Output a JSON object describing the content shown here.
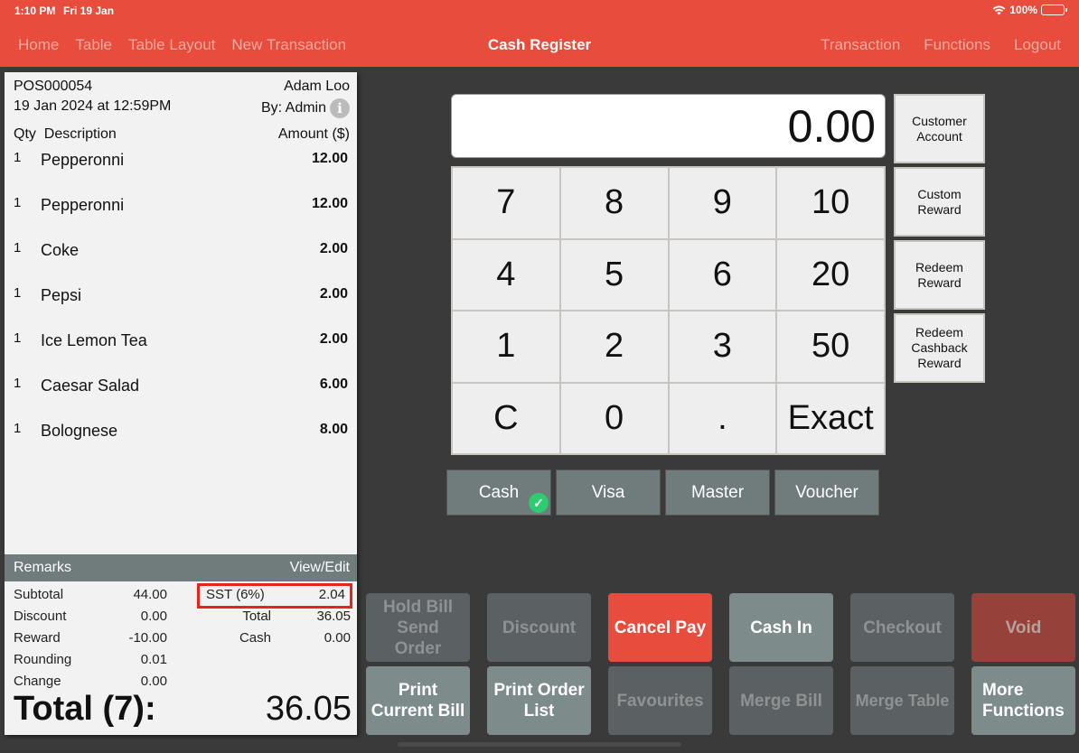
{
  "status_bar": {
    "time": "1:10 PM",
    "date": "Fri 19 Jan",
    "battery": "100%",
    "battery_level_percent": 100
  },
  "nav": {
    "left": [
      "Home",
      "Table",
      "Table Layout",
      "New Transaction"
    ],
    "title": "Cash Register",
    "right": [
      "Transaction",
      "Functions",
      "Logout"
    ]
  },
  "colors": {
    "brand": "#e74c3c",
    "background": "#3a3a3a",
    "payment_selected": "#2ecc71",
    "highlight": "#e8231b"
  },
  "receipt": {
    "order_no": "POS000054",
    "customer": "Adam Loo",
    "datetime": "19 Jan 2024 at 12:59PM",
    "by": "By: Admin",
    "info_icon": "i",
    "headers": {
      "qty_desc": "Qty  Description",
      "amount": "Amount ($)"
    },
    "items": [
      {
        "qty": "1",
        "desc": "Pepperonni",
        "amount": "12.00"
      },
      {
        "qty": "1",
        "desc": "Pepperonni",
        "amount": "12.00"
      },
      {
        "qty": "1",
        "desc": "Coke",
        "amount": "2.00"
      },
      {
        "qty": "1",
        "desc": "Pepsi",
        "amount": "2.00"
      },
      {
        "qty": "1",
        "desc": "Ice Lemon Tea",
        "amount": "2.00"
      },
      {
        "qty": "1",
        "desc": "Caesar Salad",
        "amount": "6.00"
      },
      {
        "qty": "1",
        "desc": "Bolognese",
        "amount": "8.00"
      }
    ],
    "remarks_label": "Remarks",
    "remarks_action": "View/Edit",
    "summary_left": [
      {
        "label": "Subtotal",
        "value": "44.00"
      },
      {
        "label": "Discount",
        "value": "0.00"
      },
      {
        "label": "Reward",
        "value": "-10.00"
      },
      {
        "label": "Rounding",
        "value": "0.01"
      },
      {
        "label": "Change",
        "value": "0.00"
      }
    ],
    "summary_right": [
      {
        "label": "SST (6%)",
        "value": "2.04"
      },
      {
        "label": "Total",
        "value": "36.05"
      },
      {
        "label": "Cash",
        "value": "0.00"
      }
    ],
    "total_label": "Total (7):",
    "total_value": "36.05"
  },
  "register": {
    "display": "0.00",
    "keys": [
      "7",
      "8",
      "9",
      "10",
      "4",
      "5",
      "6",
      "20",
      "1",
      "2",
      "3",
      "50",
      "C",
      "0",
      ".",
      "Exact"
    ],
    "side_buttons": [
      "Customer Account",
      "Custom Reward",
      "Redeem Reward",
      "Redeem Cashback Reward"
    ],
    "payment_methods": [
      "Cash",
      "Visa",
      "Master",
      "Voucher"
    ],
    "selected_payment": "Cash"
  },
  "functions": [
    {
      "label": "Hold Bill Send Order",
      "state": "disabled"
    },
    {
      "label": "Discount",
      "state": "disabled"
    },
    {
      "label": "Cancel Pay",
      "state": "red"
    },
    {
      "label": "Cash In",
      "state": "active"
    },
    {
      "label": "Checkout",
      "state": "disabled"
    },
    {
      "label": "Void",
      "state": "darkred"
    },
    {
      "label": "Print Current Bill",
      "state": "active"
    },
    {
      "label": "Print Order List",
      "state": "active"
    },
    {
      "label": "Favourites",
      "state": "disabled"
    },
    {
      "label": "Merge Bill",
      "state": "disabled"
    },
    {
      "label": "Merge Table",
      "state": "disabled"
    },
    {
      "label": "More Functions",
      "state": "active"
    }
  ]
}
